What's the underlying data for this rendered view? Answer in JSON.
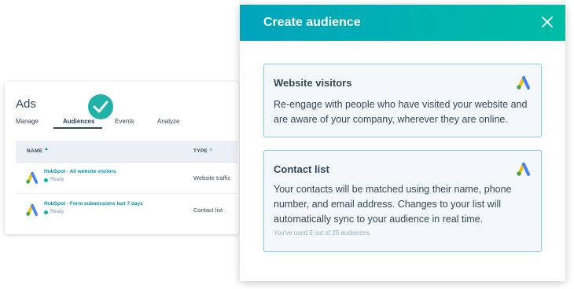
{
  "ads_panel": {
    "title": "Ads",
    "tabs": [
      {
        "label": "Manage",
        "active": false
      },
      {
        "label": "Audiences",
        "active": true
      },
      {
        "label": "Events",
        "active": false
      },
      {
        "label": "Analyze",
        "active": false
      }
    ],
    "table": {
      "columns": [
        "NAME",
        "TYPE"
      ],
      "rows": [
        {
          "name": "HubSpot - All website visitors",
          "status": "Ready",
          "type": "Website traffic"
        },
        {
          "name": "HubSpot - Form submissions last 7 days",
          "status": "Ready",
          "type": "Contact list"
        }
      ]
    }
  },
  "modal": {
    "title": "Create audience",
    "cards": [
      {
        "title": "Website visitors",
        "description": "Re-engage with people who have visited your website and are aware of your company, wherever they are online."
      },
      {
        "title": "Contact list",
        "description": "Your contacts will be matched using their name, phone number, and email address. Changes to your list will automatically sync to your audience in real time.",
        "note": "You've used 5 out of 25 audiences."
      }
    ]
  },
  "colors": {
    "header_gradient_start": "#00a4bd",
    "header_gradient_end": "#00bda5",
    "link": "#0091ae",
    "status_ready": "#00bda5",
    "card_border": "#7fd1de",
    "check_badge": "#1fb3a8"
  },
  "icons": [
    "check-icon",
    "google-ads-icon",
    "close-icon",
    "sort-ascending-icon",
    "status-dot-icon"
  ]
}
